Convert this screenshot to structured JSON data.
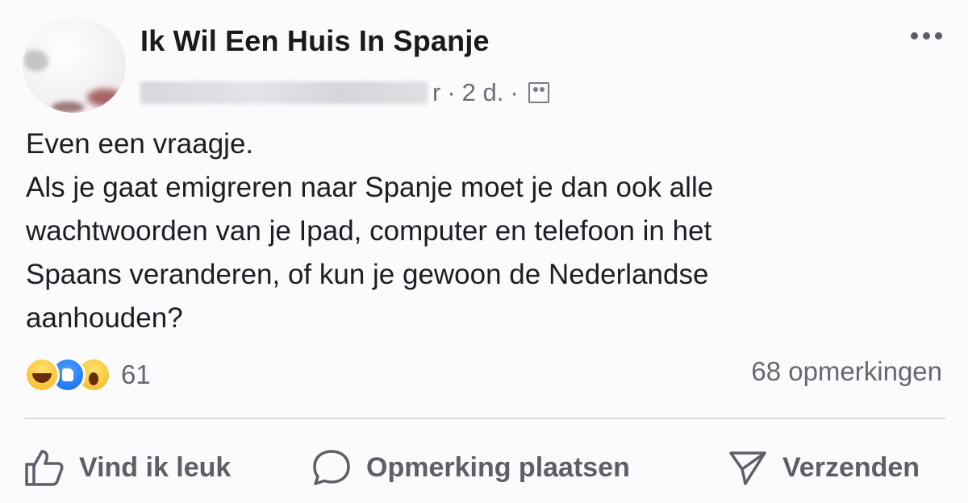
{
  "post": {
    "group_name": "Ik Wil Een Huis In Spanje",
    "author_suffix": "r",
    "time": "2 d.",
    "separator": "·",
    "body_lines": [
      "Even een vraagje.",
      "Als je gaat emigreren naar Spanje moet je dan ook alle",
      "wachtwoorden van je Ipad, computer en telefoon in het",
      "Spaans veranderen, of kun je gewoon de Nederlandse",
      "aanhouden?"
    ]
  },
  "stats": {
    "reaction_icons": [
      "haha-icon",
      "like-reaction-icon",
      "wow-icon"
    ],
    "reaction_count": "61",
    "comments": "68 opmerkingen"
  },
  "actions": {
    "like_label": "Vind ik leuk",
    "comment_label": "Opmerking plaatsen",
    "share_label": "Verzenden"
  },
  "colors": {
    "background": "#fbfafc",
    "text": "#1c1e21",
    "secondary_text": "#65686e",
    "like_blue": "#1266e8",
    "reaction_yellow": "#f5b625"
  }
}
